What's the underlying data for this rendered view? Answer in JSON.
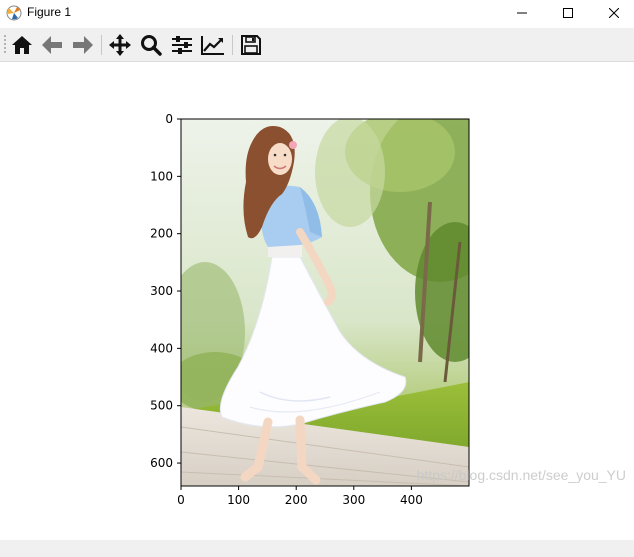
{
  "window": {
    "title": "Figure 1",
    "minimize_icon": "minimize-icon",
    "maximize_icon": "maximize-icon",
    "close_icon": "close-icon"
  },
  "toolbar": {
    "buttons": [
      {
        "name": "home",
        "icon": "home-icon"
      },
      {
        "name": "back",
        "icon": "arrow-left-icon"
      },
      {
        "name": "forward",
        "icon": "arrow-right-icon"
      },
      {
        "name": "pan",
        "icon": "move-icon"
      },
      {
        "name": "zoom",
        "icon": "magnifier-icon"
      },
      {
        "name": "subplots",
        "icon": "sliders-icon"
      },
      {
        "name": "customize",
        "icon": "line-chart-icon"
      },
      {
        "name": "save",
        "icon": "floppy-disk-icon"
      }
    ]
  },
  "plot": {
    "image_description_icon": "photo-image",
    "xticks": [
      "0",
      "100",
      "200",
      "300",
      "400"
    ],
    "yticks": [
      "0",
      "100",
      "200",
      "300",
      "400",
      "500",
      "600"
    ],
    "xlim": [
      0,
      500
    ],
    "ylim": [
      0,
      640
    ],
    "axis_color": "#000000"
  },
  "watermark": "https://blog.csdn.net/see_you_YU"
}
